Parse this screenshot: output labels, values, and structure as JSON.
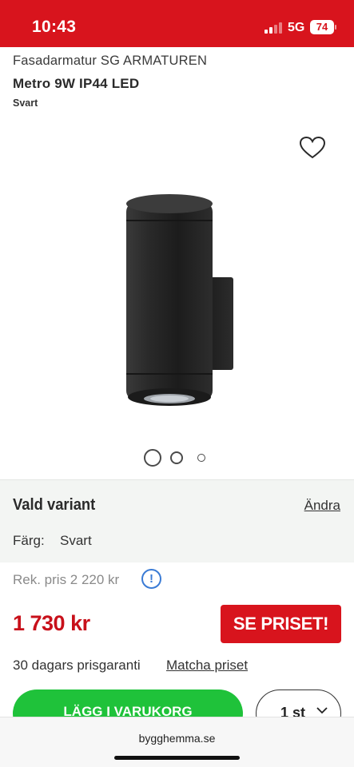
{
  "status_bar": {
    "time": "10:43",
    "network": "5G",
    "battery": "74",
    "background_color": "#d8141d"
  },
  "product": {
    "category": "Fasadarmatur SG ARMATUREN",
    "title": "Metro 9W IP44 LED",
    "variant": "Svart",
    "image_icon": "wall-light-product-image",
    "gallery_dots": 3,
    "gallery_active_index": 0
  },
  "variant_panel": {
    "heading": "Vald variant",
    "change_link": "Ändra",
    "color_label": "Färg:",
    "color_value": "Svart"
  },
  "pricing": {
    "rrp": "Rek. pris 2 220 kr",
    "price": "1 730 kr",
    "see_price_button": "SE PRISET!",
    "guarantee": "30 dagars prisgaranti",
    "match_link": "Matcha priset",
    "price_color": "#c8101a"
  },
  "cart": {
    "add_button": "LÄGG I VARUKORG",
    "quantity": "1 st",
    "button_color": "#1fc23a"
  },
  "browser": {
    "url": "bygghemma.se"
  }
}
